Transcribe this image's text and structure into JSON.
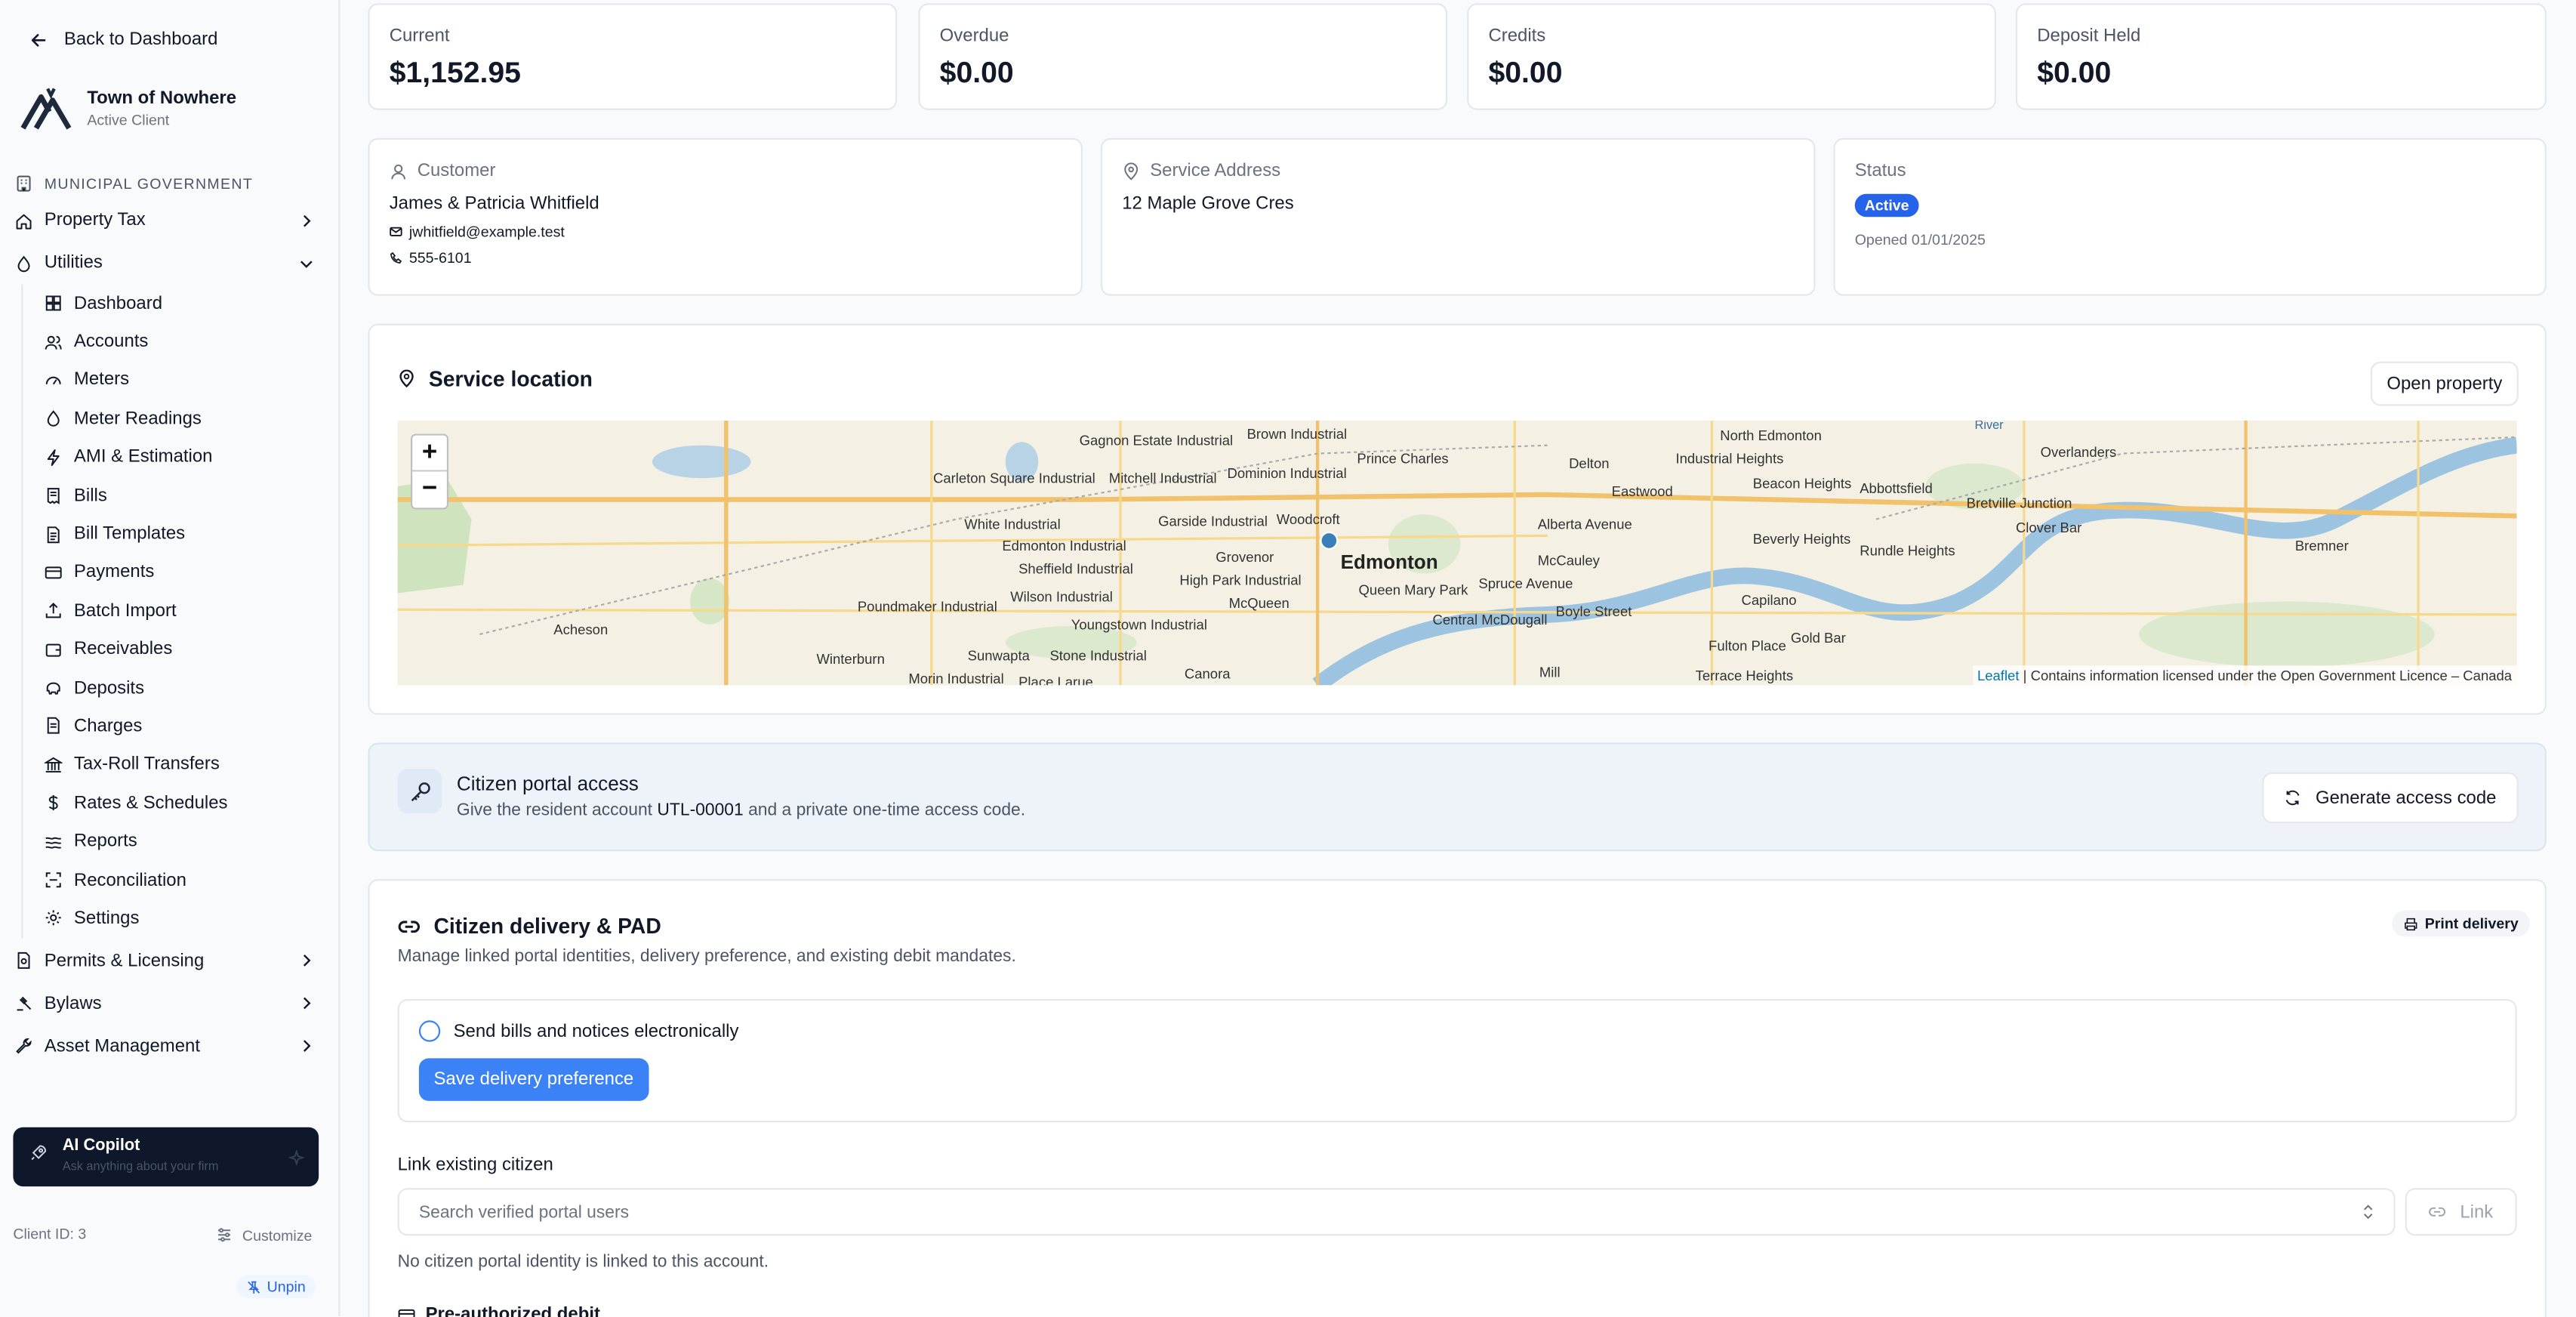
{
  "sidebar": {
    "back_label": "Back to Dashboard",
    "org_name": "Town of Nowhere",
    "org_status": "Active Client",
    "section_label": "MUNICIPAL GOVERNMENT",
    "top_items": {
      "property_tax": "Property Tax",
      "utilities": "Utilities",
      "permits": "Permits & Licensing",
      "bylaws": "Bylaws",
      "assets": "Asset Management"
    },
    "utilities_items": [
      "Dashboard",
      "Accounts",
      "Meters",
      "Meter Readings",
      "AMI & Estimation",
      "Bills",
      "Bill Templates",
      "Payments",
      "Batch Import",
      "Receivables",
      "Deposits",
      "Charges",
      "Tax-Roll Transfers",
      "Rates & Schedules",
      "Reports",
      "Reconciliation",
      "Settings"
    ],
    "copilot_title": "AI Copilot",
    "copilot_sub": "Ask anything about your firm",
    "client_id": "Client ID: 3",
    "customize": "Customize",
    "unpin": "Unpin"
  },
  "stats": [
    {
      "label": "Current",
      "value": "$1,152.95"
    },
    {
      "label": "Overdue",
      "value": "$0.00"
    },
    {
      "label": "Credits",
      "value": "$0.00"
    },
    {
      "label": "Deposit Held",
      "value": "$0.00"
    }
  ],
  "customer": {
    "heading": "Customer",
    "name": "James & Patricia Whitfield",
    "email": "jwhitfield@example.test",
    "phone": "555-6101"
  },
  "service_address": {
    "heading": "Service Address",
    "address": "12 Maple Grove Cres"
  },
  "status": {
    "heading": "Status",
    "badge": "Active",
    "opened": "Opened 01/01/2025"
  },
  "service_location": {
    "title": "Service location",
    "open_property": "Open property",
    "map": {
      "city": "Edmonton",
      "zoom_in": "+",
      "zoom_out": "−",
      "river_label": "River",
      "attribution_link": "Leaflet",
      "attribution_text": "| Contains information licensed under the Open Government Licence – Canada",
      "places": [
        "Gagnon Estate Industrial",
        "Brown Industrial",
        "North Edmonton",
        "Overlanders",
        "Carleton Square Industrial",
        "Mitchell Industrial",
        "Dominion Industrial",
        "Prince Charles",
        "Delton",
        "Industrial Heights",
        "Eastwood",
        "Beacon Heights",
        "Abbottsfield",
        "Bretville Junction",
        "Clover Bar",
        "White Industrial",
        "Edmonton Industrial",
        "Garside Industrial",
        "Woodcroft",
        "Alberta Avenue",
        "Beverly Heights",
        "Rundle Heights",
        "Bremner",
        "Sheffield Industrial",
        "Grovenor",
        "McCauley",
        "High Park Industrial",
        "Queen Mary Park",
        "Spruce Avenue",
        "Wilson Industrial",
        "Poundmaker Industrial",
        "McQueen",
        "Capilano",
        "Boyle Street",
        "Central McDougall",
        "Youngstown Industrial",
        "Acheson",
        "Fulton Place",
        "Gold Bar",
        "Sunwapta",
        "Stone Industrial",
        "Winterburn",
        "Morin Industrial",
        "Place Larue",
        "Canora",
        "Mill",
        "Terrace Heights"
      ]
    }
  },
  "portal": {
    "title": "Citizen portal access",
    "sub_before": "Give the resident account",
    "account": "UTL-00001",
    "sub_after": "and a private one-time access code.",
    "generate": "Generate access code"
  },
  "delivery": {
    "title": "Citizen delivery & PAD",
    "subtitle": "Manage linked portal identities, delivery preference, and existing debit mandates.",
    "print": "Print delivery",
    "electronic_label": "Send bills and notices electronically",
    "save_label": "Save delivery preference",
    "link_label": "Link existing citizen",
    "search_placeholder": "Search verified portal users",
    "link_button": "Link",
    "no_link": "No citizen portal identity is linked to this account.",
    "pad_title": "Pre-authorized debit"
  },
  "colors": {
    "accent": "#3b82f6",
    "badge": "#2563eb",
    "copilot_bg": "#0f172a"
  }
}
